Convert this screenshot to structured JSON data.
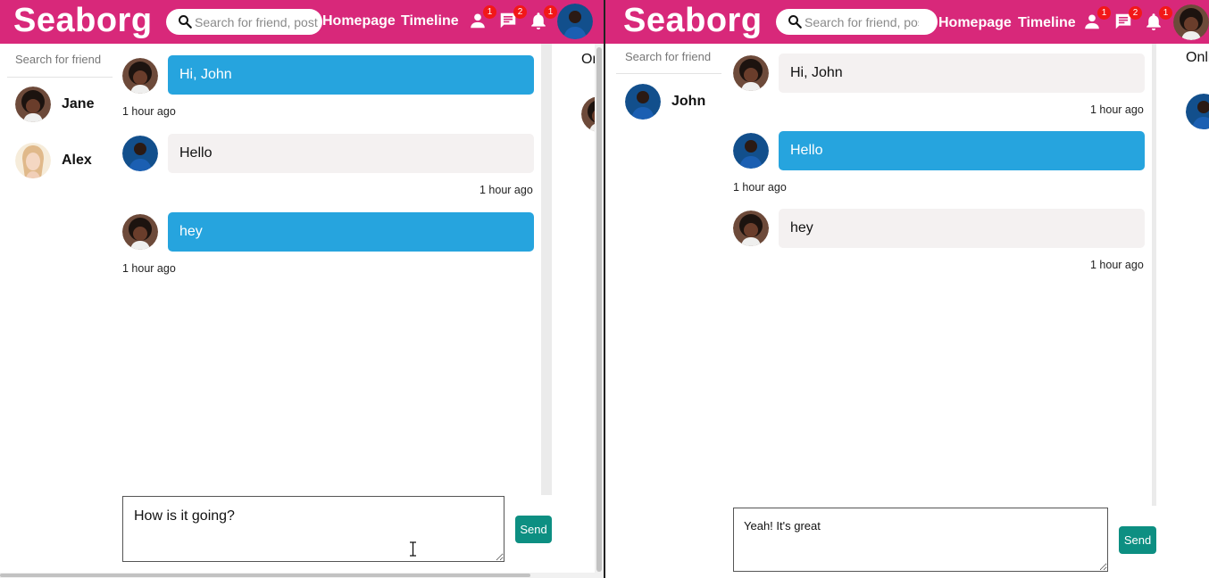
{
  "app": {
    "logo": "Seaborg",
    "search_placeholder": "Search for friend, post or video",
    "nav": {
      "homepage": "Homepage",
      "timeline": "Timeline"
    },
    "badges": {
      "friend_requests": "1",
      "messages": "2",
      "notifications": "1"
    }
  },
  "colors": {
    "topbar": "#d8287a",
    "own_bubble": "#26a4de",
    "other_bubble": "#f4f1f1",
    "send_button": "#0d8f82",
    "badge": "#f21818"
  },
  "icons": {
    "search": "search-icon",
    "friends": "person-icon",
    "messages": "chat-icon",
    "notifications": "bell-icon"
  },
  "left_window": {
    "friend_search_placeholder": "Search for friend",
    "friends": [
      {
        "name": "Jane"
      },
      {
        "name": "Alex"
      }
    ],
    "messages": [
      {
        "text": "Hi, John",
        "time": "1 hour ago",
        "own": true
      },
      {
        "text": "Hello",
        "time": "1 hour ago",
        "own": false
      },
      {
        "text": "hey",
        "time": "1 hour ago",
        "own": true
      }
    ],
    "input_value": "How is it going?",
    "send_label": "Send",
    "online_title": "Online users"
  },
  "right_window": {
    "friend_search_placeholder": "Search for friend",
    "friends": [
      {
        "name": "John"
      }
    ],
    "messages": [
      {
        "text": "Hi, John",
        "time": "1 hour ago",
        "own": false
      },
      {
        "text": "Hello",
        "time": "1 hour ago",
        "own": true
      },
      {
        "text": "hey",
        "time": "1 hour ago",
        "own": false
      }
    ],
    "input_value": "Yeah! It's great",
    "send_label": "Send",
    "online_title": "Online users"
  }
}
